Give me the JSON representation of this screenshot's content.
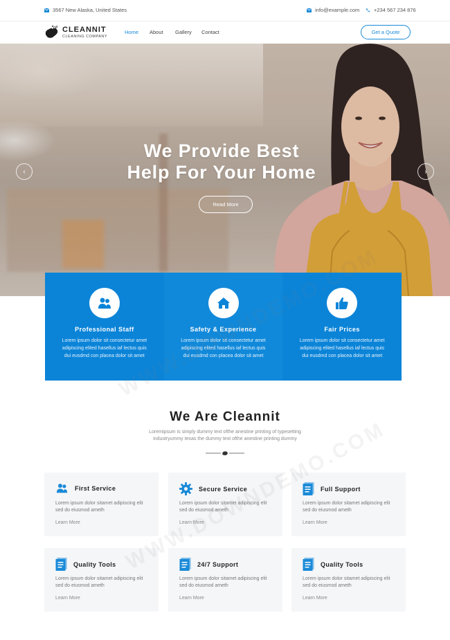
{
  "topbar": {
    "address": "3567 New Alaska, United States",
    "email": "info@example.com",
    "phone": "+234 567 234 876"
  },
  "header": {
    "logo_title": "CLEANNIT",
    "logo_subtitle": "CLEANING COMPANY",
    "nav": [
      "Home",
      "About",
      "Gallery",
      "Contact"
    ],
    "quote_button": "Get a Quote"
  },
  "hero": {
    "title_line1": "We Provide Best",
    "title_line2": "Help For Your Home",
    "button": "Read More",
    "prev": "‹",
    "next": "›"
  },
  "features": [
    {
      "icon": "users-icon",
      "title": "Professional Staff",
      "text": "Lorem ipsum dolor sit consectetur amet adipiscing elited hasellus iaf lectus quis dui eusdmd con placea dolor sit amet"
    },
    {
      "icon": "home-icon",
      "title": "Safety & Experience",
      "text": "Lorem ipsum dolor sit consectetur amet adipiscing elited hasellus iaf lectus quis dui eusdmd con placea dolor sit amet"
    },
    {
      "icon": "thumbs-up-icon",
      "title": "Fair Prices",
      "text": "Lorem ipsum dolor sit consectetur amet adipiscing elited hasellus iaf lectus quis dui eusdmd con placea dolor sit amet"
    }
  ],
  "about": {
    "title": "We Are Cleannit",
    "line1": "Loremipsum is simply dummy text ofthe anestine printing of typesetting",
    "line2": "industryummy texas the dummy text ofthe anestine printing dummy"
  },
  "services": [
    {
      "icon": "users-icon",
      "title": "First Service",
      "desc": "Lorem ipsum dolor sitamet adipiscing elit sed do eiusmod ameth",
      "link": "Learn More"
    },
    {
      "icon": "gear-icon",
      "title": "Secure Service",
      "desc": "Lorem ipsum dolor sitamet adipiscing elit sed do eiusmod ameth",
      "link": "Learn More"
    },
    {
      "icon": "document-icon",
      "title": "Full Support",
      "desc": "Lorem ipsum dolor sitamet adipiscing elit sed do eiusmod ameth",
      "link": "Learn More"
    },
    {
      "icon": "document-icon",
      "title": "Quality Tools",
      "desc": "Lorem ipsum dolor sitamet adipiscing elit sed do eiusmod ameth",
      "link": "Learn More"
    },
    {
      "icon": "document-icon",
      "title": "24/7 Support",
      "desc": "Lorem ipsum dolor sitamet adipiscing elit sed do eiusmod ameth",
      "link": "Learn More"
    },
    {
      "icon": "document-icon",
      "title": "Quality Tools",
      "desc": "Lorem ipsum dolor sitamet adipiscing elit sed do eiusmod ameth",
      "link": "Learn More"
    }
  ],
  "watermark": "WWW.DOWNDEMO.COM",
  "colors": {
    "accent": "#1a8ad8",
    "band": "#0b84d8",
    "card_bg": "#f5f6f8"
  }
}
